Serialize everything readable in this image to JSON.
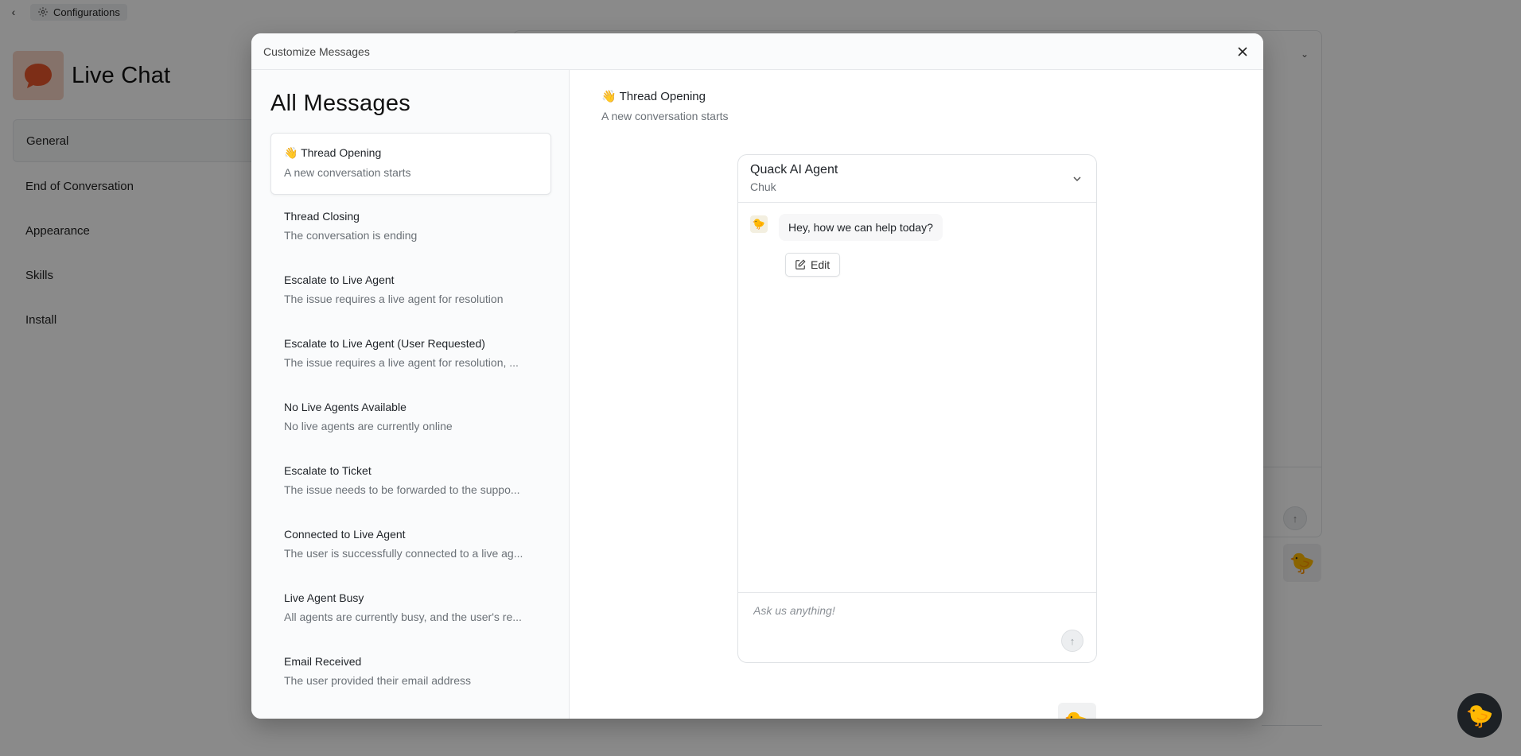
{
  "topbar": {
    "back_icon": "chevron-left-icon",
    "config_icon": "gear-icon",
    "config_label": "Configurations"
  },
  "app": {
    "title": "Live Chat",
    "logo_icon": "chat-bubble-icon",
    "logo_color": "#e8552b"
  },
  "nav": {
    "items": [
      {
        "label": "General"
      },
      {
        "label": "End of Conversation"
      },
      {
        "label": "Appearance"
      },
      {
        "label": "Skills"
      },
      {
        "label": "Install"
      }
    ]
  },
  "background_launcher": {
    "icon": "🐤"
  },
  "modal": {
    "title": "Customize Messages",
    "close_icon": "close-icon",
    "heading": "All Messages",
    "messages": [
      {
        "name": "👋 Thread Opening",
        "desc": "A new conversation starts"
      },
      {
        "name": "Thread Closing",
        "desc": "The conversation is ending"
      },
      {
        "name": "Escalate to Live Agent",
        "desc": "The issue requires a live agent for resolution"
      },
      {
        "name": "Escalate to Live Agent (User Requested)",
        "desc": "The issue requires a live agent for resolution, ..."
      },
      {
        "name": "No Live Agents Available",
        "desc": "No live agents are currently online"
      },
      {
        "name": "Escalate to Ticket",
        "desc": "The issue needs to be forwarded to the suppo..."
      },
      {
        "name": "Connected to Live Agent",
        "desc": "The user is successfully connected to a live ag..."
      },
      {
        "name": "Live Agent Busy",
        "desc": "All agents are currently busy, and the user's re..."
      },
      {
        "name": "Email Received",
        "desc": "The user provided their email address"
      }
    ],
    "detail": {
      "title": "👋 Thread Opening",
      "desc": "A new conversation starts"
    },
    "preview": {
      "agent_name": "Quack AI Agent",
      "agent_sub": "Chuk",
      "avatar": "🐤",
      "bot_message": "Hey, how we can help today?",
      "edit_label": "Edit",
      "input_placeholder": "Ask us anything!",
      "send_icon": "arrow-up-icon",
      "launcher_icon": "🐤"
    }
  }
}
